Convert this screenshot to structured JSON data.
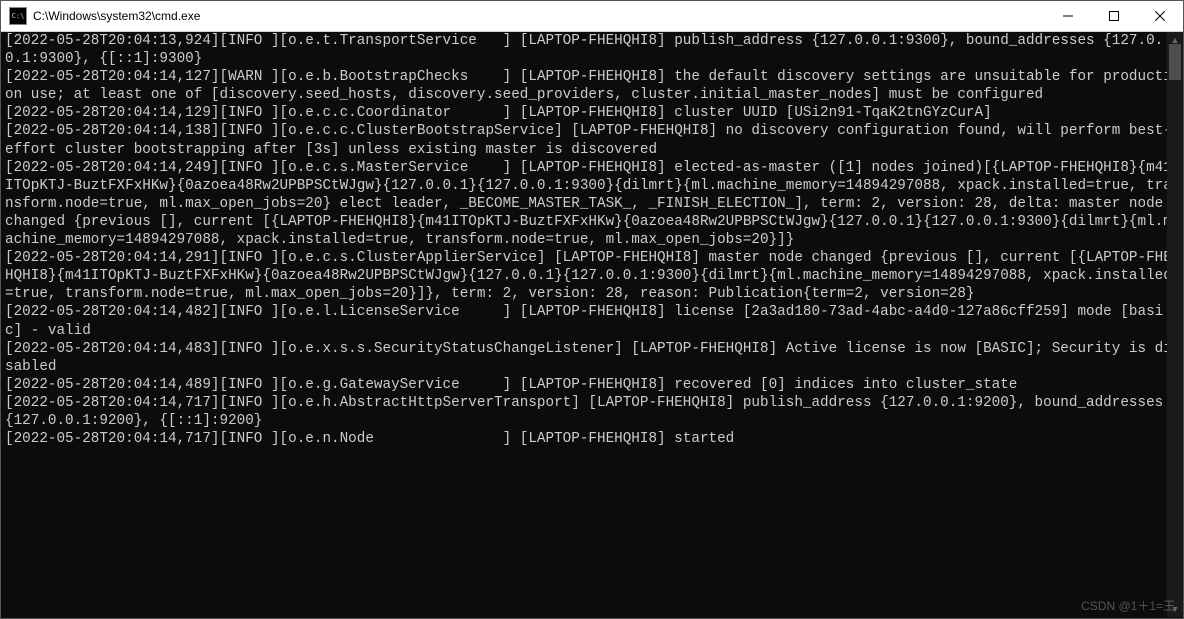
{
  "window": {
    "title": "C:\\Windows\\system32\\cmd.exe",
    "icon_text": "C:\\"
  },
  "log": {
    "lines": [
      {
        "ts": "[2022-05-28T20:04:13,924]",
        "lvl": "[INFO ]",
        "src": "[o.e.t.TransportService   ]",
        "host": "[LAPTOP-FHEHQHI8]",
        "msg": " publish_address {127.0.0.1:9300}, bound_addresses {127.0.0.1:9300}, {[::1]:9300}"
      },
      {
        "ts": "[2022-05-28T20:04:14,127]",
        "lvl": "[WARN ]",
        "src": "[o.e.b.BootstrapChecks    ]",
        "host": "[LAPTOP-FHEHQHI8]",
        "msg": " the default discovery settings are unsuitable for production use; at least one of [discovery.seed_hosts, discovery.seed_providers, cluster.initial_master_nodes] must be configured",
        "warn": true
      },
      {
        "ts": "[2022-05-28T20:04:14,129]",
        "lvl": "[INFO ]",
        "src": "[o.e.c.c.Coordinator      ]",
        "host": "[LAPTOP-FHEHQHI8]",
        "msg": " cluster UUID [USi2n91-TqaK2tnGYzCurA]"
      },
      {
        "ts": "[2022-05-28T20:04:14,138]",
        "lvl": "[INFO ]",
        "src": "[o.e.c.c.ClusterBootstrapService]",
        "host": "[LAPTOP-FHEHQHI8]",
        "msg": " no discovery configuration found, will perform best-effort cluster bootstrapping after [3s] unless existing master is discovered"
      },
      {
        "ts": "[2022-05-28T20:04:14,249]",
        "lvl": "[INFO ]",
        "src": "[o.e.c.s.MasterService    ]",
        "host": "[LAPTOP-FHEHQHI8]",
        "msg": " elected-as-master ([1] nodes joined)[{LAPTOP-FHEHQHI8}{m41ITOpKTJ-BuztFXFxHKw}{0azoea48Rw2UPBPSCtWJgw}{127.0.0.1}{127.0.0.1:9300}{dilmrt}{ml.machine_memory=14894297088, xpack.installed=true, transform.node=true, ml.max_open_jobs=20} elect leader, _BECOME_MASTER_TASK_, _FINISH_ELECTION_], term: 2, version: 28, delta: master node changed {previous [], current [{LAPTOP-FHEHQHI8}{m41ITOpKTJ-BuztFXFxHKw}{0azoea48Rw2UPBPSCtWJgw}{127.0.0.1}{127.0.0.1:9300}{dilmrt}{ml.machine_memory=14894297088, xpack.installed=true, transform.node=true, ml.max_open_jobs=20}]}"
      },
      {
        "ts": "[2022-05-28T20:04:14,291]",
        "lvl": "[INFO ]",
        "src": "[o.e.c.s.ClusterApplierService]",
        "host": "[LAPTOP-FHEHQHI8]",
        "msg": " master node changed {previous [], current [{LAPTOP-FHEHQHI8}{m41ITOpKTJ-BuztFXFxHKw}{0azoea48Rw2UPBPSCtWJgw}{127.0.0.1}{127.0.0.1:9300}{dilmrt}{ml.machine_memory=14894297088, xpack.installed=true, transform.node=true, ml.max_open_jobs=20}]}, term: 2, version: 28, reason: Publication{term=2, version=28}"
      },
      {
        "ts": "[2022-05-28T20:04:14,482]",
        "lvl": "[INFO ]",
        "src": "[o.e.l.LicenseService     ]",
        "host": "[LAPTOP-FHEHQHI8]",
        "msg": " license [2a3ad180-73ad-4abc-a4d0-127a86cff259] mode [basic] - valid"
      },
      {
        "ts": "[2022-05-28T20:04:14,483]",
        "lvl": "[INFO ]",
        "src": "[o.e.x.s.s.SecurityStatusChangeListener]",
        "host": "[LAPTOP-FHEHQHI8]",
        "msg": " Active license is now [BASIC]; Security is disabled"
      },
      {
        "ts": "[2022-05-28T20:04:14,489]",
        "lvl": "[INFO ]",
        "src": "[o.e.g.GatewayService     ]",
        "host": "[LAPTOP-FHEHQHI8]",
        "msg": " recovered [0] indices into cluster_state"
      },
      {
        "ts": "[2022-05-28T20:04:14,717]",
        "lvl": "[INFO ]",
        "src": "[o.e.h.AbstractHttpServerTransport]",
        "host": "[LAPTOP-FHEHQHI8]",
        "msg": " publish_address {127.0.0.1:9200}, bound_addresses {127.0.0.1:9200}, {[::1]:9200}"
      },
      {
        "ts": "[2022-05-28T20:04:14,717]",
        "lvl": "[INFO ]",
        "src": "[o.e.n.Node               ]",
        "host": "[LAPTOP-FHEHQHI8]",
        "msg": " started"
      }
    ]
  },
  "watermark": "CSDN @1＋1=王"
}
